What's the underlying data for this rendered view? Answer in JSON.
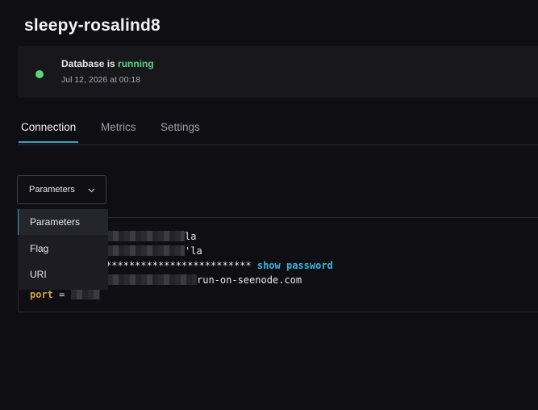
{
  "page": {
    "title": "sleepy-rosalind8"
  },
  "status": {
    "prefix": "Database is ",
    "state": "running",
    "timestamp": "Jul 12, 2026 at 00:18",
    "color": "#5bd67d"
  },
  "tabs": [
    {
      "label": "Connection",
      "active": true
    },
    {
      "label": "Metrics",
      "active": false
    },
    {
      "label": "Settings",
      "active": false
    }
  ],
  "format_select": {
    "value": "Parameters",
    "icon": "chevron-down-icon",
    "options": [
      "Parameters",
      "Flag",
      "URI"
    ]
  },
  "connection": {
    "line1_suffix": "la",
    "line2_suffix": "'la",
    "password_mask": "*************************",
    "show_password_label": "show password",
    "host_suffix": "run-on-seenode.com",
    "port_key": "port",
    "equals": " = "
  },
  "colors": {
    "accent": "#2fa3c9",
    "key": "#d2a349",
    "link": "#39b6dd"
  }
}
